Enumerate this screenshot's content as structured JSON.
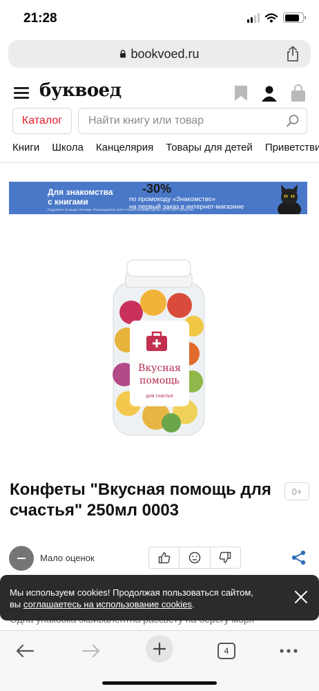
{
  "status_bar": {
    "time": "21:28"
  },
  "browser": {
    "url": "bookvoed.ru",
    "tabs_count": "4"
  },
  "site": {
    "logo": "буквоед",
    "catalog_label": "Каталог",
    "search_placeholder": "Найти книгу или товар",
    "nav": [
      "Книги",
      "Школа",
      "Канцелярия",
      "Товары для детей",
      "Приветствие"
    ]
  },
  "banner": {
    "line1": "Для знакомства",
    "line2": "с книгами",
    "discount": "-30%",
    "promo1": "по промокоду «Знакомство»",
    "promo2": "на первый заказ в интернет-магазине",
    "fine_print": "Подробнее об акции. Реклама. Рекламодатель ООО «Новый Книжный Центр» ОГРН 1027700251783"
  },
  "product": {
    "label_line1": "Вкусная",
    "label_line2": "помощь",
    "label_line3": "для счастья",
    "title": "Конфеты \"Вкусная помощь для счастья\" 250мл 0003",
    "age": "0+",
    "rating_text": "Мало оценок",
    "description": "Одна упаковка эквивалентна рассвету на берегу моря"
  },
  "cookie": {
    "text1": "Мы используем cookies! Продолжая пользоваться сайтом,",
    "text2_prefix": "вы ",
    "link": "соглашаетесь на использование cookies",
    "text2_suffix": "."
  },
  "colors": {
    "brand_red": "#e31e2d",
    "banner_blue": "#4a78c8",
    "cookie_bg": "#2b2b2b"
  }
}
